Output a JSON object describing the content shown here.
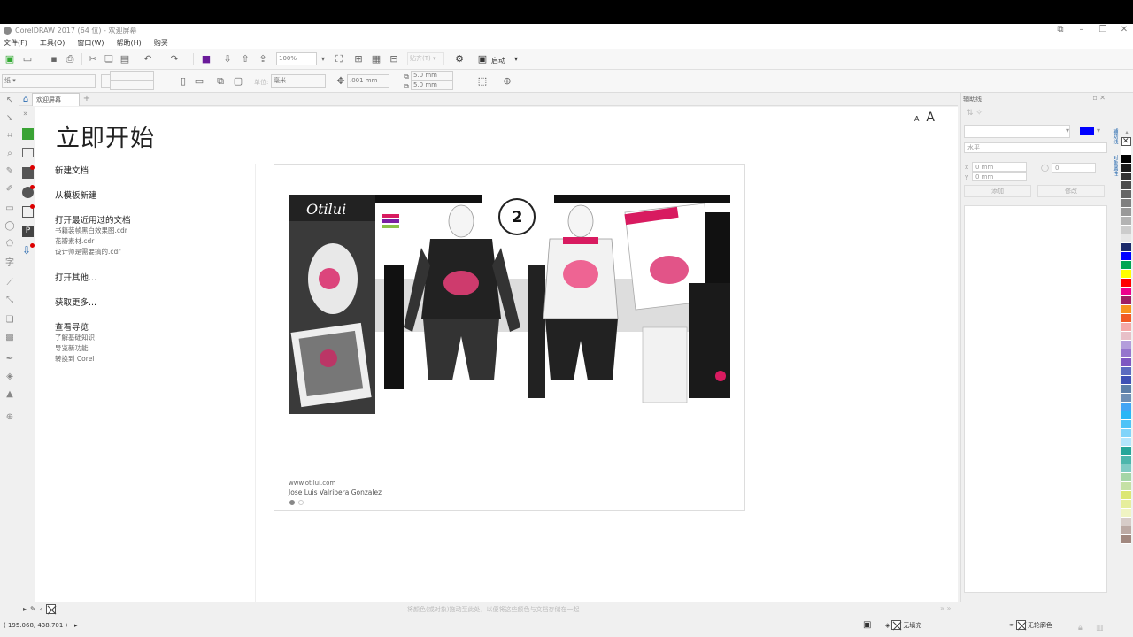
{
  "window": {
    "title": "CorelDRAW 2017 (64 位) - 欢迎屏幕",
    "controls": [
      "restore-small",
      "minimize",
      "maximize",
      "close"
    ]
  },
  "menu": [
    "文件(F)",
    "工具(O)",
    "窗口(W)",
    "帮助(H)",
    "购买"
  ],
  "toolbar": {
    "zoom_value": "100%",
    "launch_label": "启动",
    "nudge_value": ".001 mm",
    "dup_x": "5.0 mm",
    "dup_y": "5.0 mm",
    "units_placeholder": "毫米"
  },
  "tabs": {
    "active_label": "欢迎屏幕"
  },
  "welcome": {
    "title": "立即开始",
    "new_doc": "新建文档",
    "from_template": "从模板新建",
    "open_recent": "打开最近用过的文档",
    "recent_files": [
      "书籍装帧黑白效果图.cdr",
      "花瓣素材.cdr",
      "设计师是需要搞的.cdr"
    ],
    "open_other": "打开其他...",
    "get_more": "获取更多...",
    "guided_tour": "查看导览",
    "tour_items": [
      "了解基础知识",
      "导览新功能",
      "转换到 Corel"
    ]
  },
  "promo": {
    "caption_url": "www.otilui.com",
    "caption_author": "Jose Luis Valribera Gonzalez"
  },
  "docker": {
    "title": "辅助线",
    "field_x": "0 mm",
    "field_y": "0 mm",
    "field_angle": "0",
    "add_label": "添加",
    "modify_label": "修改",
    "line_type": "水平"
  },
  "status": {
    "hint": "将颜色(或对象)拖动至此处，以便将这些颜色与文档存储在一起",
    "coords": "( 195.068, 438.701 )",
    "fill_label": "无填充",
    "outline_label": "无轮廓色"
  },
  "palette_colors": [
    "#ffffff",
    "#000000",
    "#1a1a1a",
    "#333333",
    "#4d4d4d",
    "#666666",
    "#808080",
    "#999999",
    "#b3b3b3",
    "#cccccc",
    "#e6e6e6",
    "#1c2a6b",
    "#0000ff",
    "#00a651",
    "#ffff00",
    "#ff0000",
    "#ec008c",
    "#9e1f63",
    "#f7941d",
    "#f15a24",
    "#f4a9a8",
    "#e8c0c8",
    "#b39ddb",
    "#9575cd",
    "#7e57c2",
    "#5c6bc0",
    "#3f51b5",
    "#5c7fa8",
    "#6e8fb5",
    "#42a5f5",
    "#29b6f6",
    "#4fc3f7",
    "#81d4fa",
    "#b3e5fc",
    "#26a69a",
    "#4db6ac",
    "#80cbc4",
    "#a5d6a7",
    "#c5e1a5",
    "#dce775",
    "#e6ee9c",
    "#f0f4c3",
    "#d7ccc8",
    "#bcaaa4",
    "#a1887f"
  ]
}
